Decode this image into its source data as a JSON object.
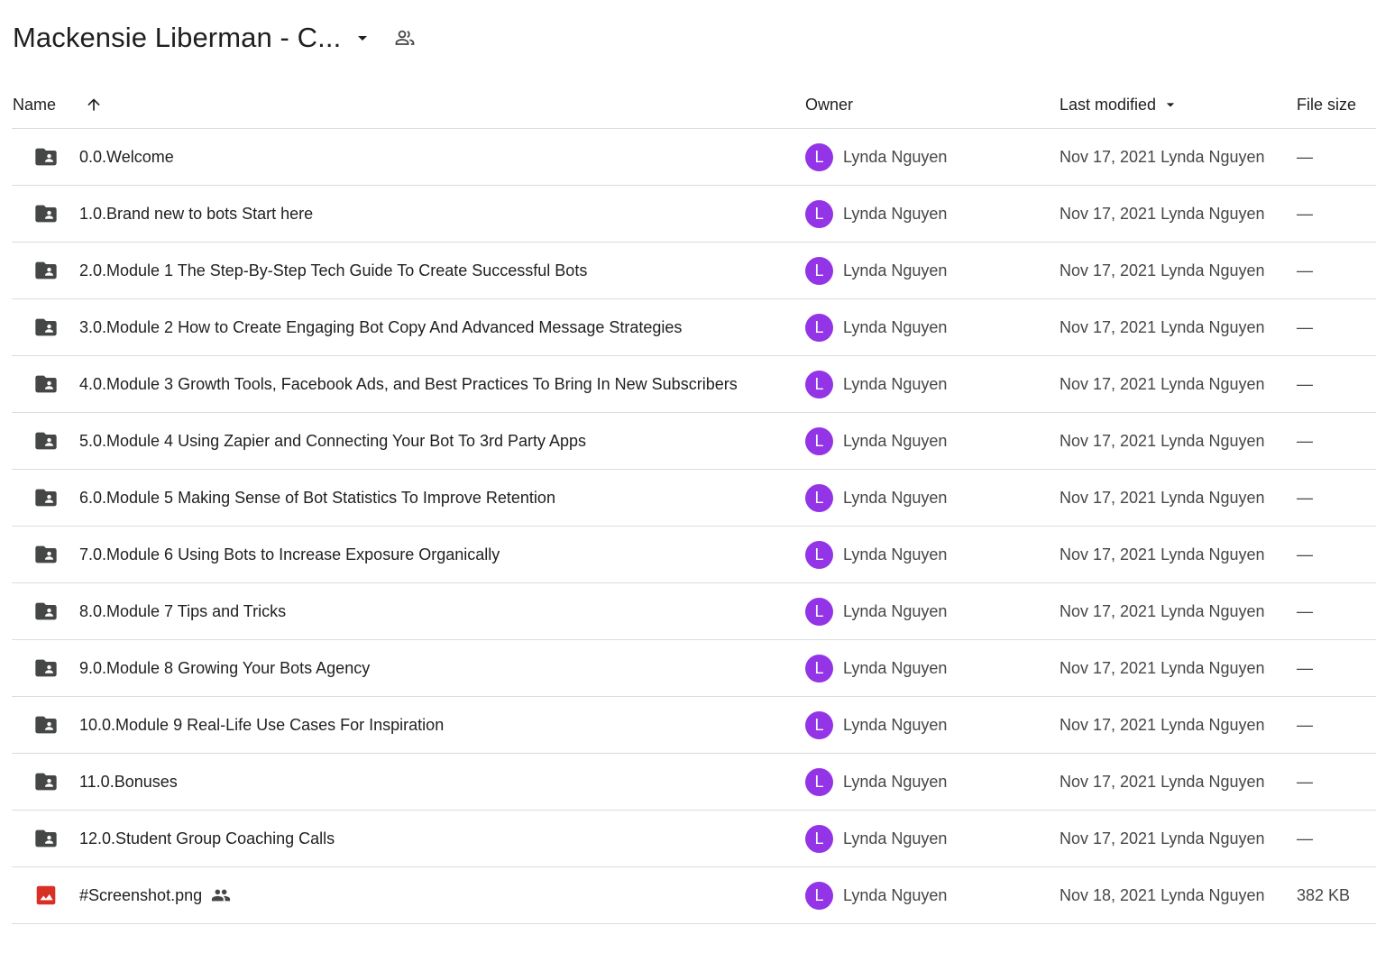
{
  "title": {
    "text": "Mackensie Liberman - C...",
    "dropdown_icon": "arrow-drop-down-icon",
    "shared_icon": "shared-people-icon"
  },
  "columns": {
    "name": "Name",
    "sort_icon": "arrow-up-icon",
    "owner": "Owner",
    "last_modified": "Last modified",
    "last_modified_icon": "arrow-drop-down-icon",
    "file_size": "File size"
  },
  "colors": {
    "avatar": "#9334e6",
    "folder_icon": "#444746",
    "image_icon": "#d93025",
    "divider": "#dadce0"
  },
  "rows": [
    {
      "type": "folder",
      "icon": "shared-folder-icon",
      "name": "0.0.Welcome",
      "avatar": "L",
      "owner": "Lynda Nguyen",
      "modified": "Nov 17, 2021 Lynda Nguyen",
      "size": "—"
    },
    {
      "type": "folder",
      "icon": "shared-folder-icon",
      "name": "1.0.Brand new to bots Start here",
      "avatar": "L",
      "owner": "Lynda Nguyen",
      "modified": "Nov 17, 2021 Lynda Nguyen",
      "size": "—"
    },
    {
      "type": "folder",
      "icon": "shared-folder-icon",
      "name": "2.0.Module 1 The Step-By-Step Tech Guide To Create Successful Bots",
      "avatar": "L",
      "owner": "Lynda Nguyen",
      "modified": "Nov 17, 2021 Lynda Nguyen",
      "size": "—"
    },
    {
      "type": "folder",
      "icon": "shared-folder-icon",
      "name": "3.0.Module 2 How to Create Engaging Bot Copy And Advanced Message Strategies",
      "avatar": "L",
      "owner": "Lynda Nguyen",
      "modified": "Nov 17, 2021 Lynda Nguyen",
      "size": "—"
    },
    {
      "type": "folder",
      "icon": "shared-folder-icon",
      "name": "4.0.Module 3 Growth Tools, Facebook Ads, and Best Practices To Bring In New Subscribers",
      "avatar": "L",
      "owner": "Lynda Nguyen",
      "modified": "Nov 17, 2021 Lynda Nguyen",
      "size": "—"
    },
    {
      "type": "folder",
      "icon": "shared-folder-icon",
      "name": "5.0.Module 4 Using Zapier and Connecting Your Bot To 3rd Party Apps",
      "avatar": "L",
      "owner": "Lynda Nguyen",
      "modified": "Nov 17, 2021 Lynda Nguyen",
      "size": "—"
    },
    {
      "type": "folder",
      "icon": "shared-folder-icon",
      "name": "6.0.Module 5 Making Sense of Bot Statistics To Improve Retention",
      "avatar": "L",
      "owner": "Lynda Nguyen",
      "modified": "Nov 17, 2021 Lynda Nguyen",
      "size": "—"
    },
    {
      "type": "folder",
      "icon": "shared-folder-icon",
      "name": "7.0.Module 6 Using Bots to Increase Exposure Organically",
      "avatar": "L",
      "owner": "Lynda Nguyen",
      "modified": "Nov 17, 2021 Lynda Nguyen",
      "size": "—"
    },
    {
      "type": "folder",
      "icon": "shared-folder-icon",
      "name": "8.0.Module 7 Tips and Tricks",
      "avatar": "L",
      "owner": "Lynda Nguyen",
      "modified": "Nov 17, 2021 Lynda Nguyen",
      "size": "—"
    },
    {
      "type": "folder",
      "icon": "shared-folder-icon",
      "name": "9.0.Module 8 Growing Your Bots Agency",
      "avatar": "L",
      "owner": "Lynda Nguyen",
      "modified": "Nov 17, 2021 Lynda Nguyen",
      "size": "—"
    },
    {
      "type": "folder",
      "icon": "shared-folder-icon",
      "name": "10.0.Module 9 Real-Life Use Cases For Inspiration",
      "avatar": "L",
      "owner": "Lynda Nguyen",
      "modified": "Nov 17, 2021 Lynda Nguyen",
      "size": "—"
    },
    {
      "type": "folder",
      "icon": "shared-folder-icon",
      "name": "11.0.Bonuses",
      "avatar": "L",
      "owner": "Lynda Nguyen",
      "modified": "Nov 17, 2021 Lynda Nguyen",
      "size": "—"
    },
    {
      "type": "folder",
      "icon": "shared-folder-icon",
      "name": "12.0.Student Group Coaching Calls",
      "avatar": "L",
      "owner": "Lynda Nguyen",
      "modified": "Nov 17, 2021 Lynda Nguyen",
      "size": "—"
    },
    {
      "type": "image",
      "icon": "image-file-icon",
      "name": "#Screenshot.png",
      "shared": true,
      "avatar": "L",
      "owner": "Lynda Nguyen",
      "modified": "Nov 18, 2021 Lynda Nguyen",
      "size": "382 KB"
    }
  ]
}
